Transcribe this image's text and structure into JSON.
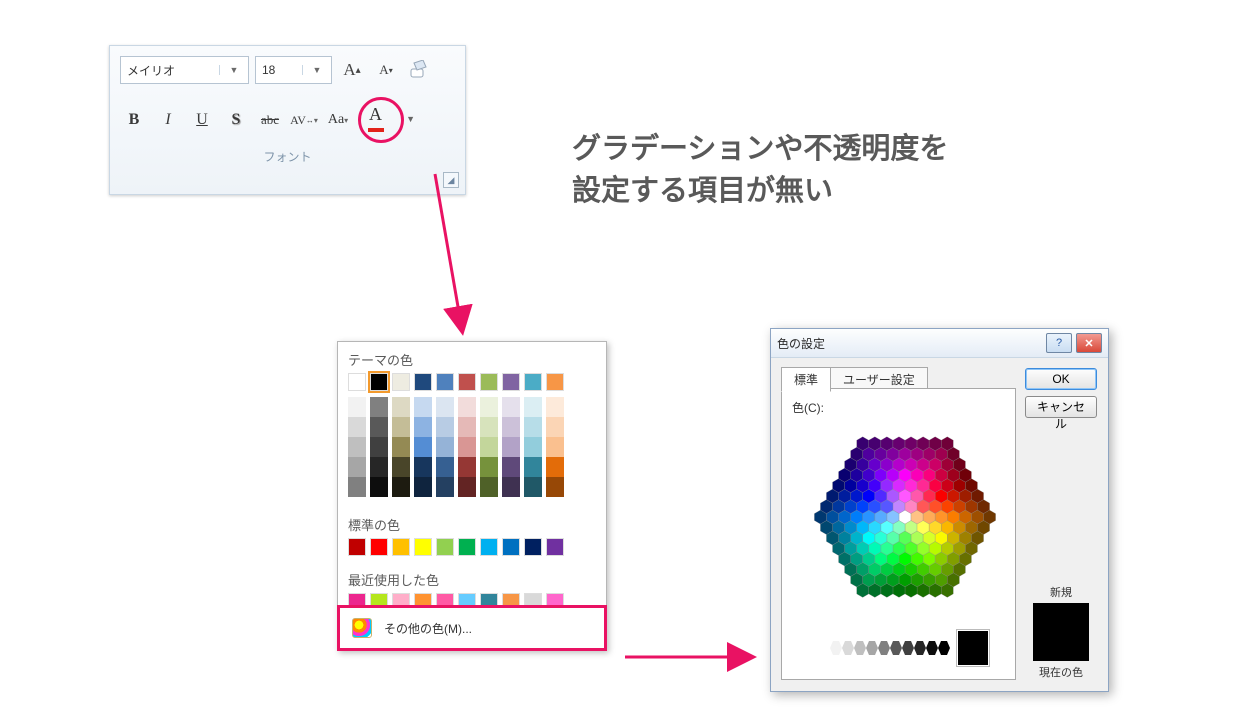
{
  "ribbon": {
    "font_name": "メイリオ",
    "font_size": "18",
    "group_label": "フォント",
    "buttons": {
      "bold": "B",
      "italic": "I",
      "underline": "U",
      "shadow": "S",
      "strike": "abc",
      "spacing": "AV",
      "case": "Aa"
    }
  },
  "note": {
    "line1": "グラデーションや不透明度を",
    "line2": "設定する項目が無い"
  },
  "dropdown": {
    "theme_label": "テーマの色",
    "standard_label": "標準の色",
    "recent_label": "最近使用した色",
    "more_label": "その他の色(M)...",
    "theme_row": [
      "#ffffff",
      "#000000",
      "#eeece1",
      "#1f497d",
      "#4f81bd",
      "#c0504d",
      "#9bbb59",
      "#8064a2",
      "#4bacc6",
      "#f79646"
    ],
    "tint_cols": [
      [
        "#f2f2f2",
        "#d9d9d9",
        "#bfbfbf",
        "#a6a6a6",
        "#808080"
      ],
      [
        "#808080",
        "#595959",
        "#404040",
        "#262626",
        "#0d0d0d"
      ],
      [
        "#ddd9c3",
        "#c4bd97",
        "#948a54",
        "#494529",
        "#1d1b10"
      ],
      [
        "#c6d9f0",
        "#8db3e2",
        "#548dd4",
        "#17365d",
        "#0f243e"
      ],
      [
        "#dbe5f1",
        "#b8cce4",
        "#95b3d7",
        "#366092",
        "#244061"
      ],
      [
        "#f2dcdb",
        "#e5b9b7",
        "#d99694",
        "#953734",
        "#632423"
      ],
      [
        "#ebf1dd",
        "#d7e3bc",
        "#c3d69b",
        "#76923c",
        "#4f6128"
      ],
      [
        "#e5e0ec",
        "#ccc1d9",
        "#b2a2c7",
        "#5f497a",
        "#3f3151"
      ],
      [
        "#dbeef3",
        "#b7dde8",
        "#92cddc",
        "#31859b",
        "#205867"
      ],
      [
        "#fdeada",
        "#fbd5b5",
        "#fac08f",
        "#e36c09",
        "#974806"
      ]
    ],
    "standard_row": [
      "#c00000",
      "#ff0000",
      "#ffc000",
      "#ffff00",
      "#92d050",
      "#00b050",
      "#00b0f0",
      "#0070c0",
      "#002060",
      "#7030a0"
    ],
    "recent_row": [
      "#ec268e",
      "#b5e61d",
      "#ffaec9",
      "#ff9331",
      "#ff5aa5",
      "#66ccff",
      "#31859b",
      "#f79646",
      "#d9d9d9",
      "#ff66cc"
    ]
  },
  "dialog": {
    "title": "色の設定",
    "tab_standard": "標準",
    "tab_custom": "ユーザー設定",
    "color_label": "色(C):",
    "ok": "OK",
    "cancel": "キャンセル",
    "new_label": "新規",
    "current_label": "現在の色",
    "new_color": "#000000",
    "current_color": "#000000",
    "grays": [
      "#ffffff",
      "#f2f2f2",
      "#d9d9d9",
      "#bfbfbf",
      "#a6a6a6",
      "#808080",
      "#595959",
      "#404040",
      "#262626",
      "#0d0d0d",
      "#000000"
    ]
  }
}
